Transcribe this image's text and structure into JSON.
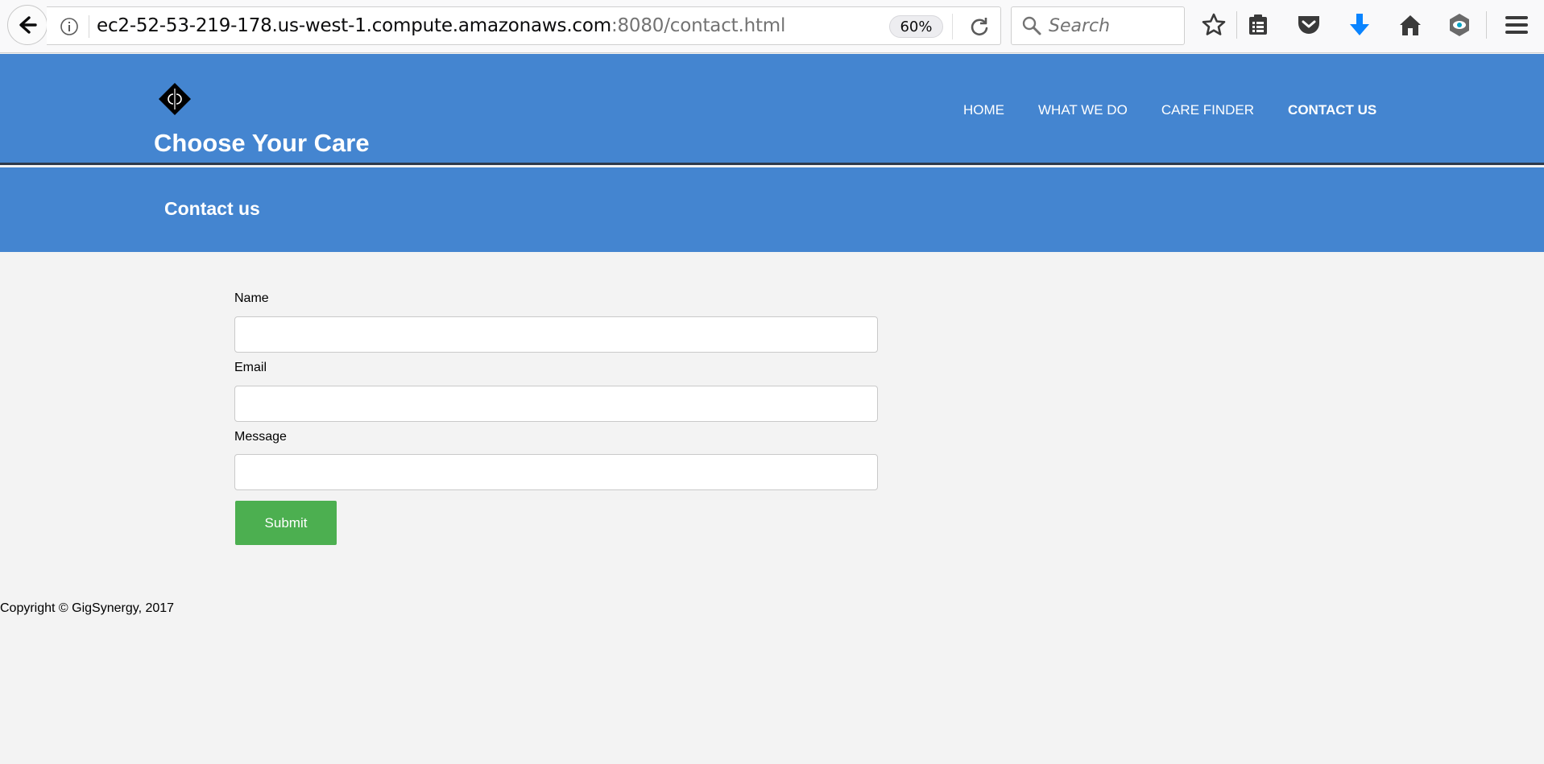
{
  "browser": {
    "url_host": "ec2-52-53-219-178.us-west-1.compute.amazonaws.com",
    "url_path": ":8080/contact.html",
    "zoom": "60%",
    "search_placeholder": "Search"
  },
  "header": {
    "site_title": "Choose Your Care",
    "nav": [
      {
        "label": "HOME",
        "active": false
      },
      {
        "label": "WHAT WE DO",
        "active": false
      },
      {
        "label": "CARE FINDER",
        "active": false
      },
      {
        "label": "CONTACT US",
        "active": true
      }
    ]
  },
  "page": {
    "heading": "Contact us"
  },
  "form": {
    "name_label": "Name",
    "name_value": "",
    "email_label": "Email",
    "email_value": "",
    "message_label": "Message",
    "message_value": "",
    "submit_label": "Submit"
  },
  "footer": {
    "copyright": "Copyright © GigSynergy, 2017"
  },
  "colors": {
    "header_bg": "#4485d0",
    "submit_bg": "#4caf50",
    "page_bg": "#f3f3f3",
    "download_accent": "#0a84ff"
  }
}
